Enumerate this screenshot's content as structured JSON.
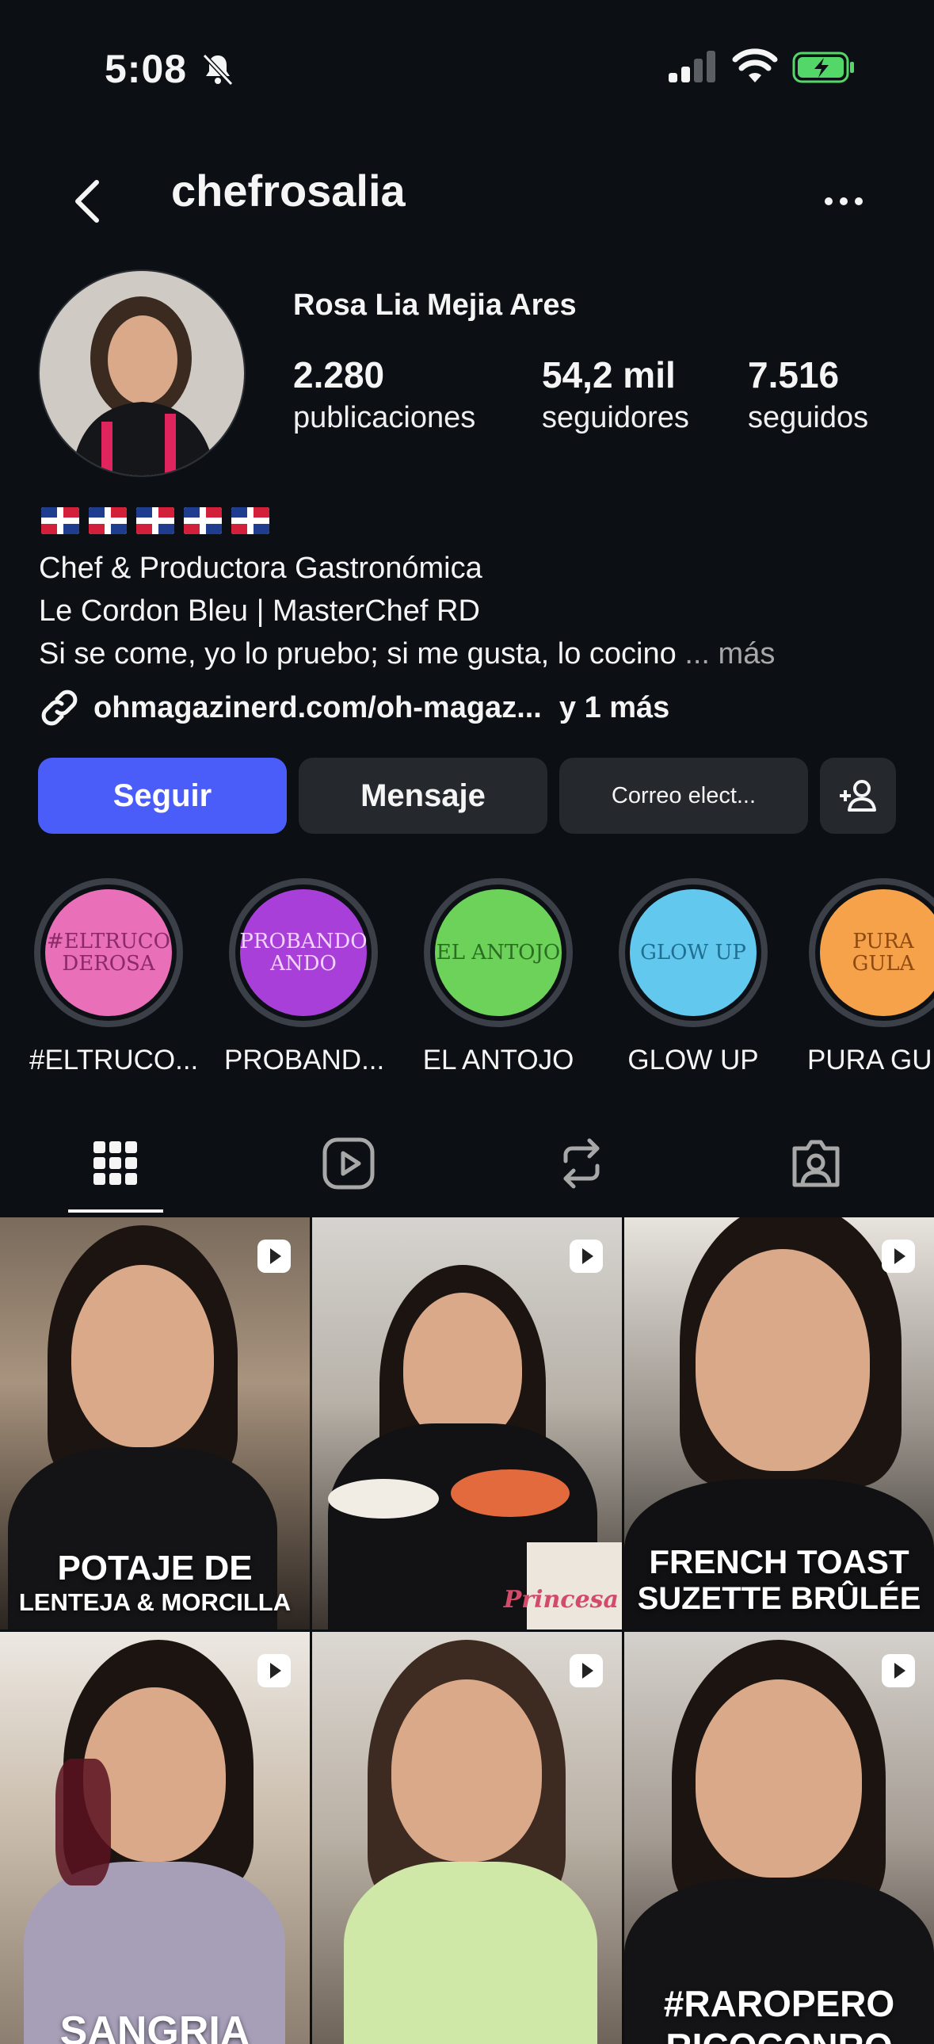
{
  "status_bar": {
    "time": "5:08"
  },
  "header": {
    "username": "chefrosalia"
  },
  "profile": {
    "full_name": "Rosa Lia Mejia Ares",
    "stats": [
      {
        "value": "2.280",
        "label": "publicaciones"
      },
      {
        "value": "54,2 mil",
        "label": "seguidores"
      },
      {
        "value": "7.516",
        "label": "seguidos"
      }
    ],
    "bio_lines": [
      "Chef & Productora Gastronómica",
      "Le Cordon Bleu | MasterChef RD",
      "Si se come, yo lo pruebo; si me gusta, lo cocino"
    ],
    "bio_more": "... más",
    "link_text": "ohmagazinerd.com/oh-magaz...",
    "link_more": "y 1 más"
  },
  "actions": {
    "follow": "Seguir",
    "message": "Mensaje",
    "email": "Correo elect..."
  },
  "highlights": [
    {
      "label": "#ELTRUCO...",
      "art": "#ELTRUCO DEROSA",
      "color": "#e86fb8",
      "text_color": "#8a2a66"
    },
    {
      "label": "PROBAND...",
      "art": "PROBANDO ANDO",
      "color": "#a83fd8",
      "text_color": "#f3d4ff"
    },
    {
      "label": "EL ANTOJO",
      "art": "EL ANTOJO",
      "color": "#6cd25a",
      "text_color": "#2b6d21"
    },
    {
      "label": "GLOW UP",
      "art": "GLOW UP",
      "color": "#63c8ee",
      "text_color": "#1f6f92"
    },
    {
      "label": "PURA GU",
      "art": "PURA GULA",
      "color": "#f5a24a",
      "text_color": "#8f4a11"
    }
  ],
  "grid_posts": [
    {
      "caption_l1": "POTAJE DE",
      "caption_l2": "LENTEJA & MORCILLA"
    },
    {
      "caption_l1": "",
      "caption_l2": "Princesa"
    },
    {
      "caption_l1": "FRENCH TOAST",
      "caption_l2": "SUZETTE BRÛLÉE"
    },
    {
      "caption_l1": "SANGRIA",
      "caption_l2": ""
    },
    {
      "caption_l1": "",
      "caption_l2": ""
    },
    {
      "caption_l1": "#RAROPERO",
      "caption_l2": "RICOCONRO"
    }
  ]
}
